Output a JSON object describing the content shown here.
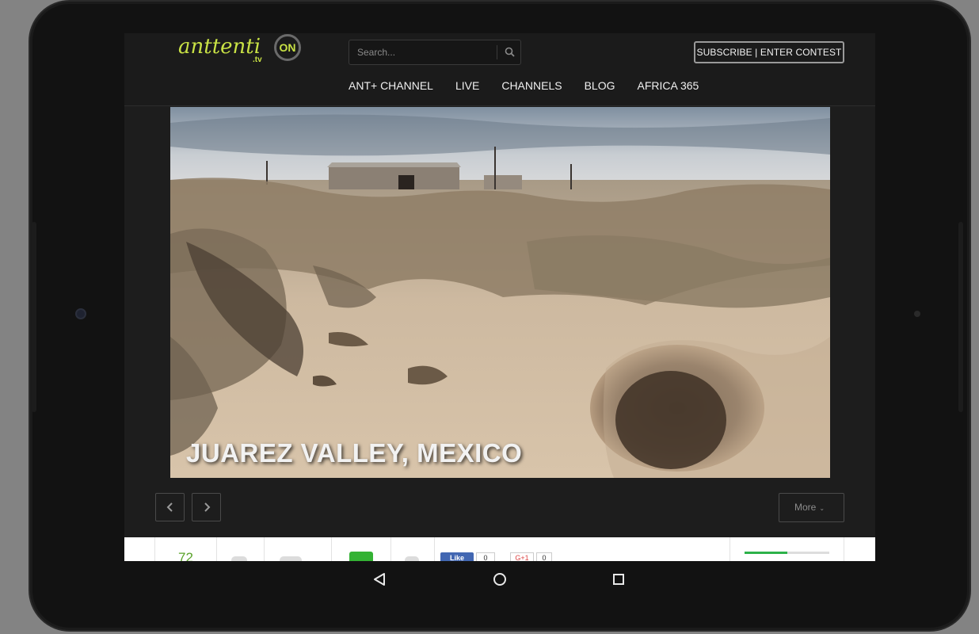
{
  "header": {
    "logo_main": "anttenti",
    "logo_tv": ".tv",
    "logo_on": "ON",
    "search_placeholder": "Search...",
    "subscribe_label": "SUBSCRIBE | ENTER CONTEST"
  },
  "nav": {
    "items": [
      "ANT+ CHANNEL",
      "LIVE",
      "CHANNELS",
      "BLOG",
      "AFRICA 365"
    ]
  },
  "hero": {
    "caption": "JUAREZ VALLEY, MEXICO"
  },
  "controls": {
    "more_label": "More"
  },
  "stats": {
    "views": "72",
    "fb_like": "Like",
    "fb_count": "0",
    "gplus_label": "G+1",
    "gplus_count": "0",
    "rating_progress": 0.5
  },
  "colors": {
    "accent_green": "#c9e245",
    "progress_green": "#2db24a"
  }
}
